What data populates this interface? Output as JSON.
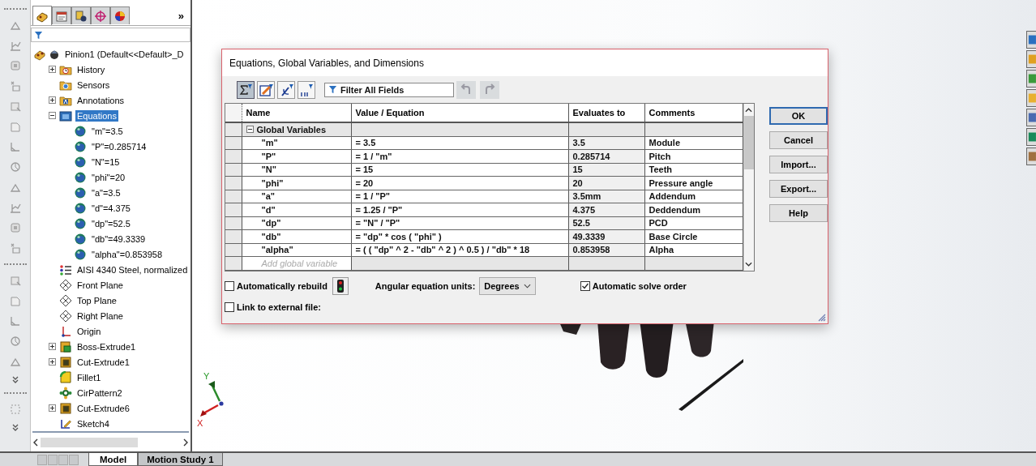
{
  "feature_manager": {
    "tabs": [
      {
        "kind": "tree",
        "selected": true
      },
      {
        "kind": "property",
        "selected": false
      },
      {
        "kind": "config",
        "selected": false
      },
      {
        "kind": "dimxpert",
        "selected": false
      },
      {
        "kind": "display",
        "selected": false
      }
    ],
    "more": "»",
    "tree": {
      "label": "Pinion1  (Default<<Default>_D",
      "kind": "part",
      "selected": false,
      "children": [
        {
          "label": "History",
          "kind": "history",
          "expanded": false,
          "selected": false
        },
        {
          "label": "Sensors",
          "kind": "sensors",
          "selected": false
        },
        {
          "label": "Annotations",
          "kind": "annotations",
          "expanded": false,
          "selected": false
        },
        {
          "label": "Equations",
          "kind": "equations",
          "expanded": true,
          "selected": true,
          "children": [
            {
              "label": "\"m\"=3.5",
              "kind": "equation",
              "selected": false
            },
            {
              "label": "\"P\"=0.285714",
              "kind": "equation",
              "selected": false
            },
            {
              "label": "\"N\"=15",
              "kind": "equation",
              "selected": false
            },
            {
              "label": "\"phi\"=20",
              "kind": "equation",
              "selected": false
            },
            {
              "label": "\"a\"=3.5",
              "kind": "equation",
              "selected": false
            },
            {
              "label": "\"d\"=4.375",
              "kind": "equation",
              "selected": false
            },
            {
              "label": "\"dp\"=52.5",
              "kind": "equation",
              "selected": false
            },
            {
              "label": "\"db\"=49.3339",
              "kind": "equation",
              "selected": false
            },
            {
              "label": "\"alpha\"=0.853958",
              "kind": "equation",
              "selected": false
            }
          ]
        },
        {
          "label": "AISI 4340 Steel, normalized",
          "kind": "material",
          "selected": false
        },
        {
          "label": "Front Plane",
          "kind": "plane",
          "selected": false
        },
        {
          "label": "Top Plane",
          "kind": "plane",
          "selected": false
        },
        {
          "label": "Right Plane",
          "kind": "plane",
          "selected": false
        },
        {
          "label": "Origin",
          "kind": "origin",
          "selected": false
        },
        {
          "label": "Boss-Extrude1",
          "kind": "boss",
          "expanded": false,
          "selected": false
        },
        {
          "label": "Cut-Extrude1",
          "kind": "cut",
          "expanded": false,
          "selected": false
        },
        {
          "label": "Fillet1",
          "kind": "fillet",
          "selected": false
        },
        {
          "label": "CirPattern2",
          "kind": "pattern",
          "selected": false
        },
        {
          "label": "Cut-Extrude6",
          "kind": "cut",
          "expanded": false,
          "selected": false
        },
        {
          "label": "Sketch4",
          "kind": "sketch",
          "selected": false
        }
      ]
    }
  },
  "viewport": {
    "triad": {
      "x": "X",
      "y": "Y"
    }
  },
  "dialog": {
    "title": "Equations, Global Variables, and Dimensions",
    "toolbar": {
      "views": [
        {
          "kind": "equation",
          "selected": true
        },
        {
          "kind": "sketch",
          "selected": false
        },
        {
          "kind": "dimension",
          "selected": false
        },
        {
          "kind": "ordered",
          "selected": false
        }
      ],
      "filter": {
        "placeholder": "Filter All Fields"
      },
      "undo": {
        "disabled": true
      },
      "redo": {
        "disabled": true
      }
    },
    "table": {
      "columns": [
        "Name",
        "Value / Equation",
        "Evaluates to",
        "Comments"
      ],
      "group": {
        "label": "Global Variables",
        "expanded": true
      },
      "rows": [
        {
          "name": "\"m\"",
          "value": "= 3.5",
          "evaluates": "3.5",
          "comment": "Module"
        },
        {
          "name": "\"P\"",
          "value": "= 1 / \"m\"",
          "evaluates": "0.285714",
          "comment": "Pitch"
        },
        {
          "name": "\"N\"",
          "value": "= 15",
          "evaluates": "15",
          "comment": "Teeth"
        },
        {
          "name": "\"phi\"",
          "value": "= 20",
          "evaluates": "20",
          "comment": "Pressure angle"
        },
        {
          "name": "\"a\"",
          "value": "= 1 / \"P\"",
          "evaluates": "3.5mm",
          "comment": "Addendum"
        },
        {
          "name": "\"d\"",
          "value": "= 1.25 / \"P\"",
          "evaluates": "4.375",
          "comment": "Deddendum"
        },
        {
          "name": "\"dp\"",
          "value": "= \"N\" / \"P\"",
          "evaluates": "52.5",
          "comment": "PCD"
        },
        {
          "name": "\"db\"",
          "value": "= \"dp\" * cos ( \"phi\" )",
          "evaluates": "49.3339",
          "comment": "Base Circle"
        },
        {
          "name": "\"alpha\"",
          "value": "= ( ( \"dp\" ^ 2 - \"db\" ^ 2 ) ^ 0.5 ) / \"db\" * 18",
          "evaluates": "0.853958",
          "comment": "Alpha"
        }
      ],
      "add_row": {
        "placeholder": "Add global variable"
      }
    },
    "auto_rebuild": {
      "label": "Automatically rebuild",
      "checked": false
    },
    "units": {
      "label": "Angular equation units:",
      "value": "Degrees"
    },
    "solve_order": {
      "label": "Automatic solve order",
      "checked": true
    },
    "link_file": {
      "label": "Link to external file:",
      "checked": false
    },
    "buttons": [
      {
        "label": "OK",
        "focused": true
      },
      {
        "label": "Cancel",
        "focused": false
      },
      {
        "label": "Import...",
        "focused": false
      },
      {
        "label": "Export...",
        "focused": false
      },
      {
        "label": "Help",
        "focused": false
      }
    ]
  },
  "bottom_tabs": [
    {
      "label": "Model",
      "selected": true
    },
    {
      "label": "Motion Study 1",
      "selected": false
    }
  ]
}
